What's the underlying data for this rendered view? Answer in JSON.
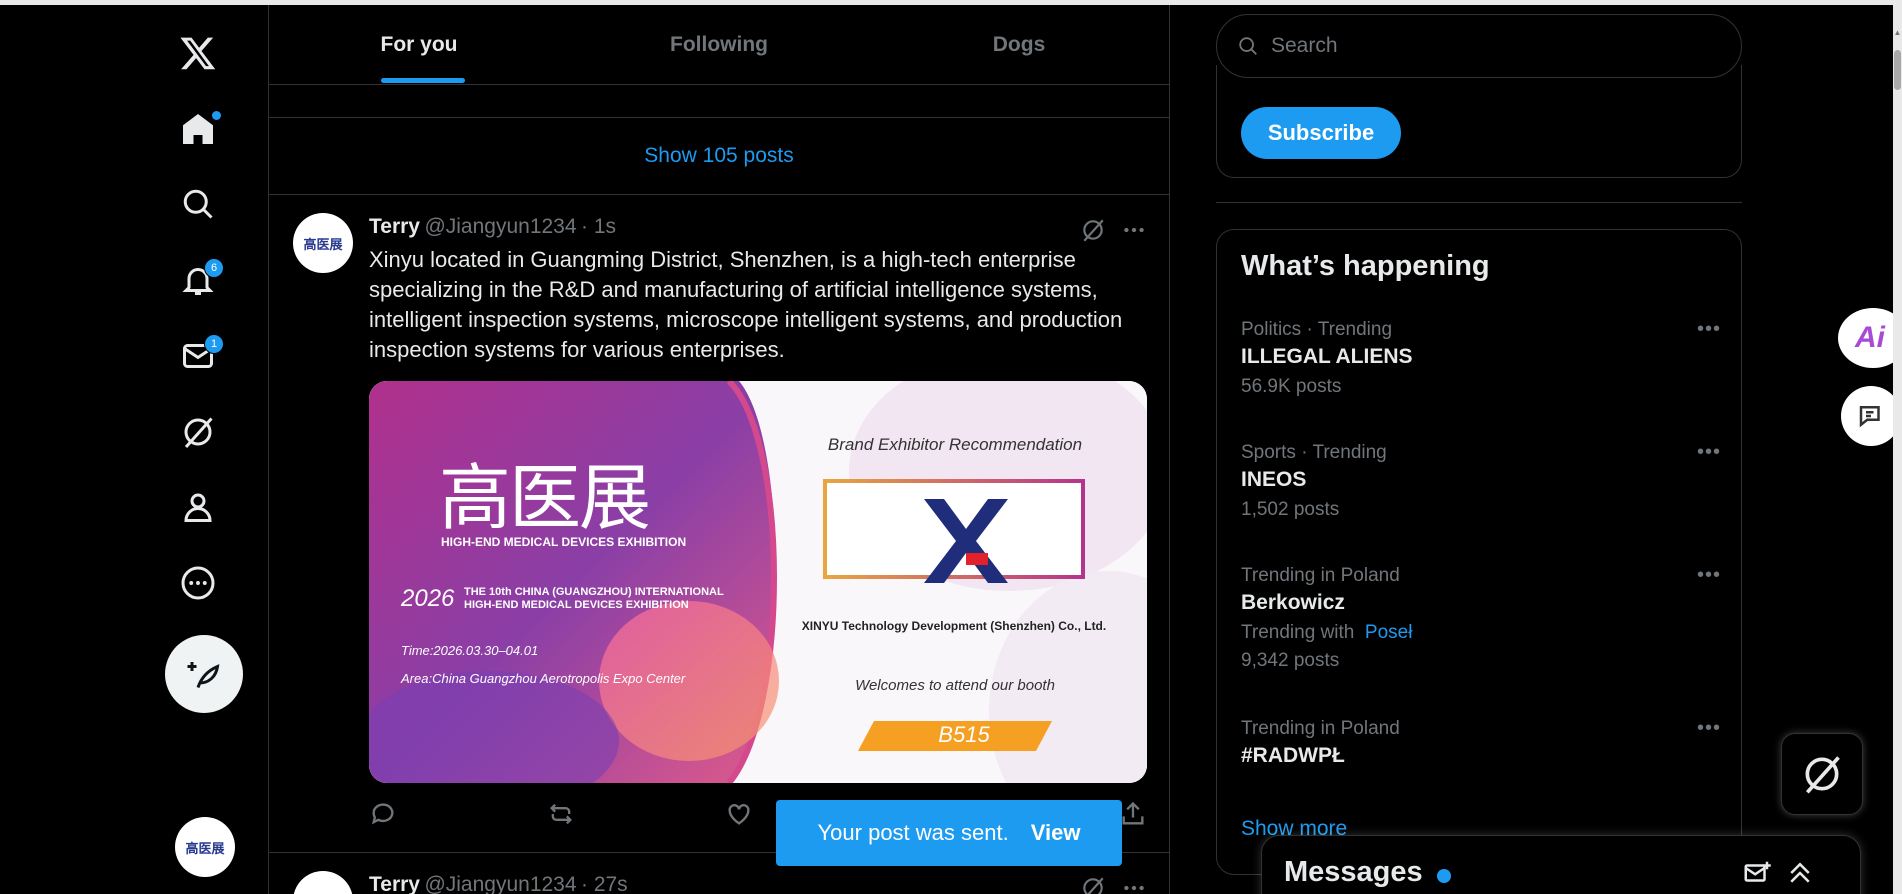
{
  "nav": {
    "notifications_count": "6",
    "messages_count": "1",
    "account_avatar_text": "高医展"
  },
  "tabs": [
    "For you",
    "Following",
    "Dogs"
  ],
  "show_posts": "Show 105 posts",
  "post1": {
    "name": "Terry",
    "handle": "@Jiangyun1234",
    "time": "· 1s",
    "text": "Xinyu located in Guangming District, Shenzhen, is a high-tech enterprise specializing in the R&D and manufacturing of artificial intelligence systems, intelligent inspection systems, microscope intelligent systems, and production inspection systems for various enterprises.",
    "avatar_text": "高医展",
    "media": {
      "logo_cn": "高医展",
      "logo_en": "HIGH-END MEDICAL DEVICES EXHIBITION",
      "year": "2026",
      "event_line1": "THE 10th CHINA (GUANGZHOU) INTERNATIONAL",
      "event_line2": "HIGH-END MEDICAL DEVICES EXHIBITION",
      "time": "Time:2026.03.30–04.01",
      "area": "Area:China Guangzhou Aerotropolis Expo Center",
      "recommend": "Brand Exhibitor Recommendation",
      "company": "XINYU Technology Development (Shenzhen) Co., Ltd.",
      "welcome": "Welcomes to attend our booth",
      "booth": "B515"
    }
  },
  "post2": {
    "name": "Terry",
    "handle": "@Jiangyun1234",
    "time": "· 27s"
  },
  "toast": {
    "message": "Your post was sent.",
    "action": "View"
  },
  "search": {
    "placeholder": "Search"
  },
  "subscribe": "Subscribe",
  "trends_title": "What’s happening",
  "trends": [
    {
      "meta": "Politics · Trending",
      "title": "ILLEGAL ALIENS",
      "count": "56.9K posts"
    },
    {
      "meta": "Sports · Trending",
      "title": "INEOS",
      "count": "1,502 posts"
    },
    {
      "meta": "Trending in Poland",
      "title": "Berkowicz",
      "with_label": "Trending with",
      "with_link": "Poseł",
      "count": "9,342 posts"
    },
    {
      "meta": "Trending in Poland",
      "title": "#RADWPŁ"
    }
  ],
  "show_more": "Show more",
  "messages_title": "Messages",
  "colors": {
    "accent": "#1d9bf0",
    "background": "#000000",
    "border": "#2f3336",
    "muted": "#71767b"
  }
}
